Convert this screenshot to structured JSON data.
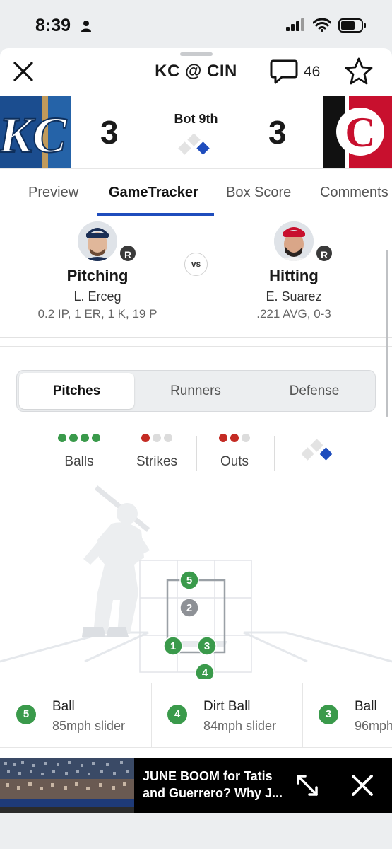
{
  "status_bar": {
    "time": "8:39"
  },
  "header": {
    "title": "KC @ CIN",
    "comment_count": "46"
  },
  "score": {
    "away_team": "KC",
    "home_team": "CIN",
    "away_score": "3",
    "home_score": "3",
    "inning": "Bot 9th"
  },
  "tabs": [
    {
      "label": "Preview"
    },
    {
      "label": "GameTracker",
      "active": true
    },
    {
      "label": "Box Score"
    },
    {
      "label": "Comments"
    }
  ],
  "matchup": {
    "pitcher": {
      "role": "Pitching",
      "name": "L. Erceg",
      "stats": "0.2 IP, 1 ER, 1 K, 19 P",
      "hand": "R"
    },
    "vs": "vs",
    "batter": {
      "role": "Hitting",
      "name": "E. Suarez",
      "stats": ".221 AVG, 0-3",
      "hand": "R"
    }
  },
  "segments": [
    {
      "label": "Pitches",
      "active": true
    },
    {
      "label": "Runners"
    },
    {
      "label": "Defense"
    }
  ],
  "count": {
    "balls": 4,
    "strikes": 1,
    "outs": 2,
    "labels": {
      "balls": "Balls",
      "strikes": "Strikes",
      "outs": "Outs"
    }
  },
  "bases": {
    "first": true,
    "second": false,
    "third": false
  },
  "pitches_on_zone": [
    {
      "number": "5",
      "type": "ball"
    },
    {
      "number": "2",
      "type": "strike"
    },
    {
      "number": "1",
      "type": "ball"
    },
    {
      "number": "3",
      "type": "ball"
    },
    {
      "number": "4",
      "type": "ball"
    }
  ],
  "pitch_list": [
    {
      "number": "5",
      "result": "Ball",
      "detail": "85mph slider"
    },
    {
      "number": "4",
      "result": "Dirt Ball",
      "detail": "84mph slider"
    },
    {
      "number": "3",
      "result": "Ball",
      "detail": "96mph"
    }
  ],
  "ad": {
    "headline_line1": "JUNE BOOM for Tatis",
    "headline_line2": "and Guerrero? Why J..."
  },
  "colors": {
    "accent_blue": "#1f4dbd",
    "ball_green": "#3a9a4b",
    "strike_gray": "#8e9196",
    "out_red": "#c42b24",
    "royals_blue": "#1b4d8f",
    "reds_red": "#c8102e"
  },
  "icons": [
    "person-icon",
    "signal-icon",
    "wifi-icon",
    "battery-icon",
    "close-icon",
    "chat-bubble-icon",
    "star-icon",
    "expand-icon"
  ]
}
